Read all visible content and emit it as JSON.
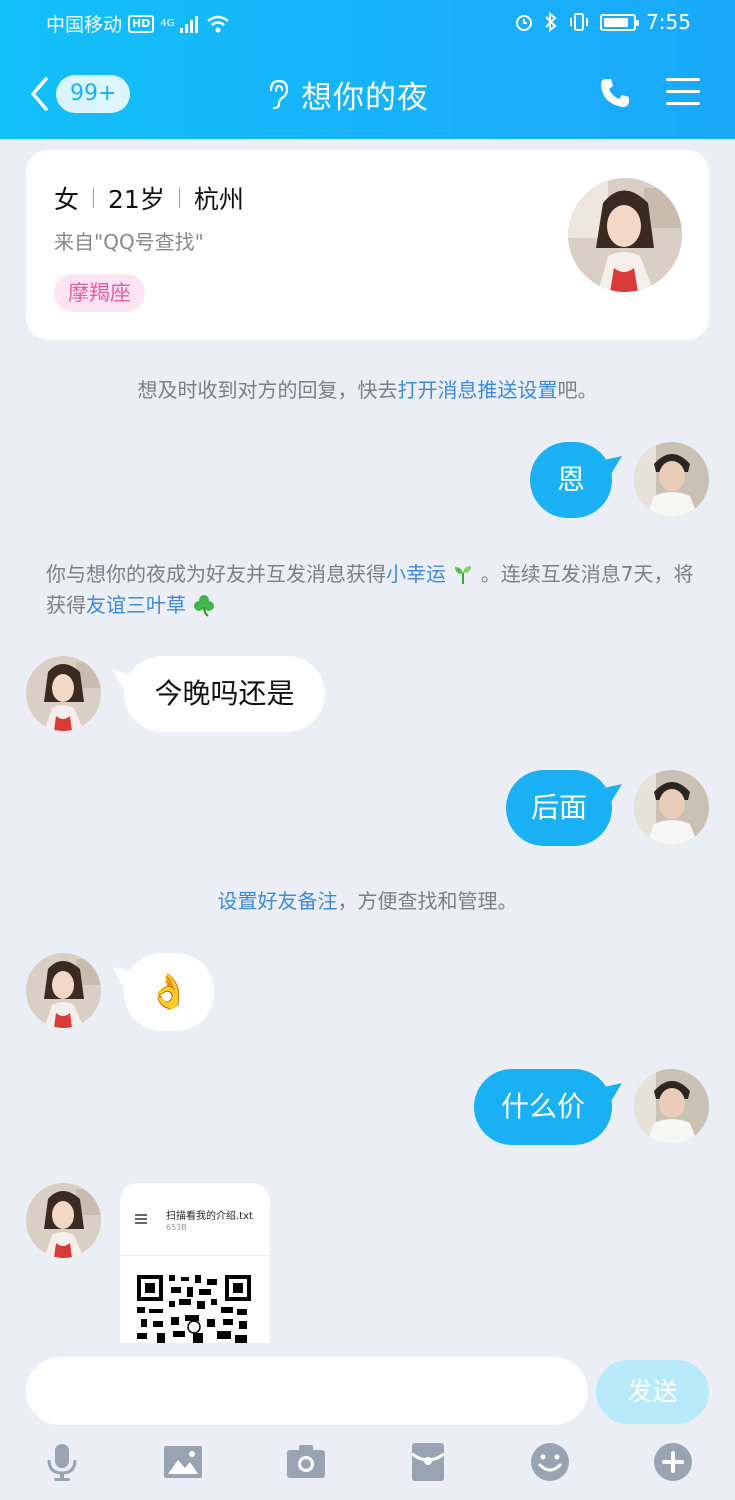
{
  "status_bar": {
    "carrier": "中国移动",
    "hd": "HD",
    "network": "4G",
    "time": "7:55",
    "battery_level": 0.85
  },
  "header": {
    "unread_badge": "99+",
    "title": "想你的夜"
  },
  "profile": {
    "gender": "女",
    "age": "21岁",
    "city": "杭州",
    "source": "来自\"QQ号查找\"",
    "tag": "摩羯座"
  },
  "messages": {
    "tip_push": {
      "before": "想及时收到对方的回复，快去",
      "link": "打开消息推送设置",
      "after": "吧。"
    },
    "out1": "恩",
    "friend_tip": {
      "t1": "你与想你的夜成为好友并互发消息获得",
      "link1": "小幸运",
      "t2": "。连续互发消息7天，将获得",
      "link2": "友谊三叶草"
    },
    "in1": "今晚吗还是",
    "out2": "后面",
    "remark_tip": {
      "link": "设置好友备注",
      "after": "，方便查找和管理。"
    },
    "in2": "👌",
    "out3": "什么价",
    "file": {
      "name": "扫描看我的介绍.txt",
      "size": "653B"
    }
  },
  "input": {
    "placeholder": "",
    "send_label": "发送"
  },
  "colors": {
    "accent": "#19B1F4",
    "link": "#3E8AD9",
    "tag": "#E55FA7"
  }
}
